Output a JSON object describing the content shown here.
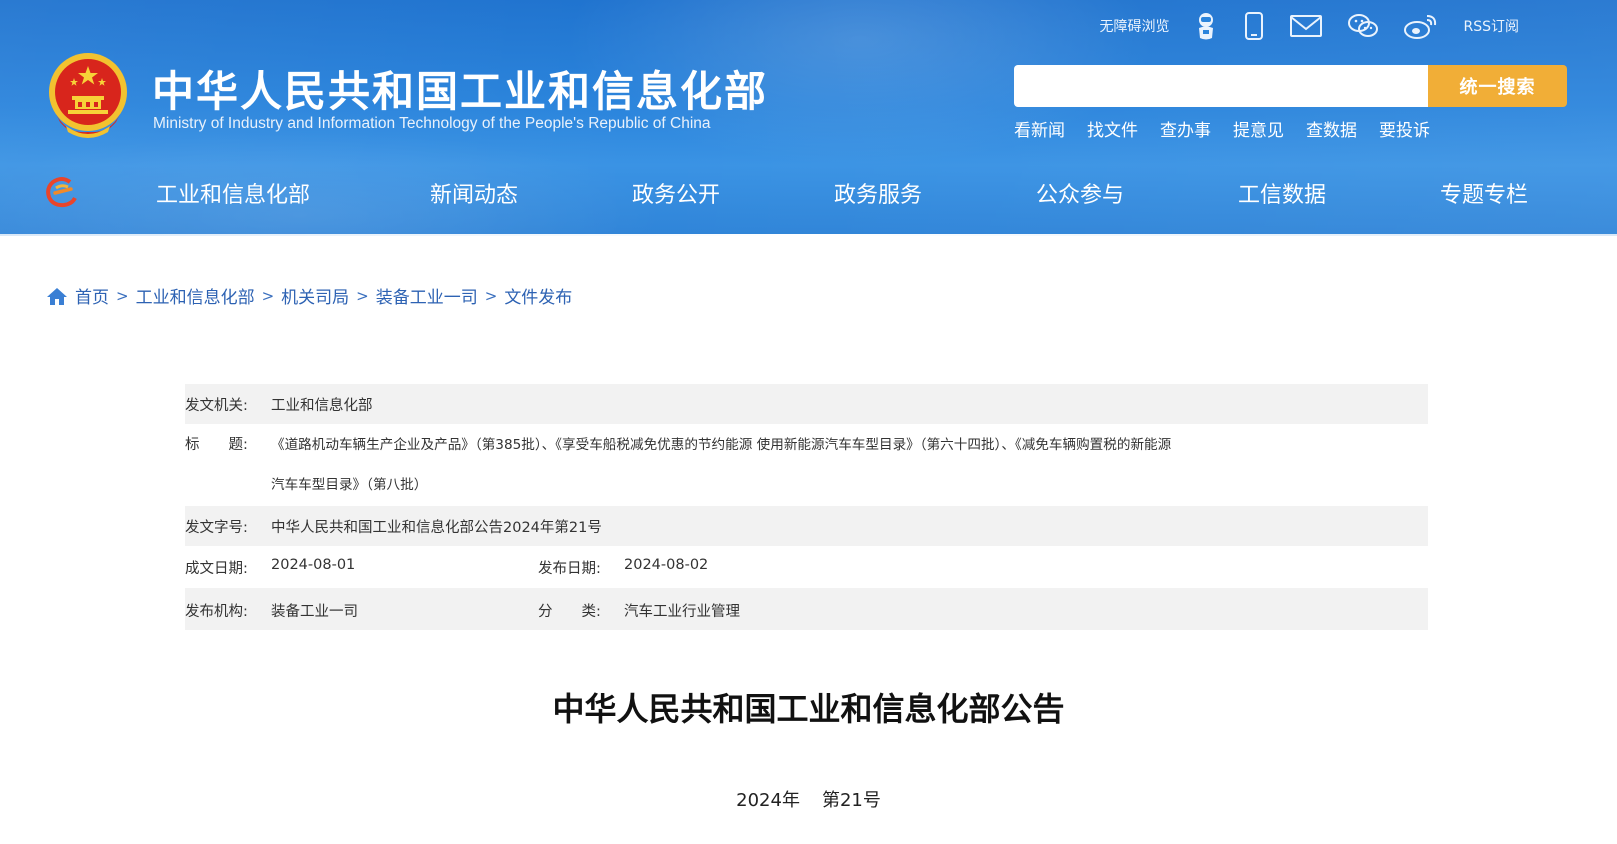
{
  "header": {
    "title_cn": "中华人民共和国工业和信息化部",
    "title_en": "Ministry of Industry and Information Technology of the People's Republic of China",
    "accessibility": "无障碍浏览",
    "rss": "RSS订阅",
    "search": {
      "placeholder": "",
      "button": "统一搜索"
    },
    "quick_links": [
      "看新闻",
      "找文件",
      "查办事",
      "提意见",
      "查数据",
      "要投诉"
    ],
    "colors": {
      "brand_blue": "#2a84dc",
      "search_button": "#f1ae37"
    },
    "icons": [
      "robot-icon",
      "mobile-icon",
      "mail-icon",
      "wechat-icon",
      "weibo-icon"
    ]
  },
  "nav": {
    "items": [
      "工业和信息化部",
      "新闻动态",
      "政务公开",
      "政务服务",
      "公众参与",
      "工信数据",
      "专题专栏"
    ]
  },
  "breadcrumb": {
    "items": [
      "首页",
      "工业和信息化部",
      "机关司局",
      "装备工业一司",
      "文件发布"
    ]
  },
  "info": {
    "issuer_label": "发文机关:",
    "issuer": "工业和信息化部",
    "title_label": "标　　题:",
    "title_line1": "《道路机动车辆生产企业及产品》（第385批）、《享受车船税减免优惠的节约能源 使用新能源汽车车型目录》（第六十四批）、《减免车辆购置税的新能源",
    "title_line2": "汽车车型目录》（第八批）",
    "doc_no_label": "发文字号:",
    "doc_no": "中华人民共和国工业和信息化部公告2024年第21号",
    "written_label": "成文日期:",
    "written": "2024-08-01",
    "published_label": "发布日期:",
    "published": "2024-08-02",
    "org_label": "发布机构:",
    "org": "装备工业一司",
    "category_label": "分　　类:",
    "category": "汽车工业行业管理"
  },
  "document": {
    "title": "中华人民共和国工业和信息化部公告",
    "year": "2024年",
    "number": "第21号"
  }
}
